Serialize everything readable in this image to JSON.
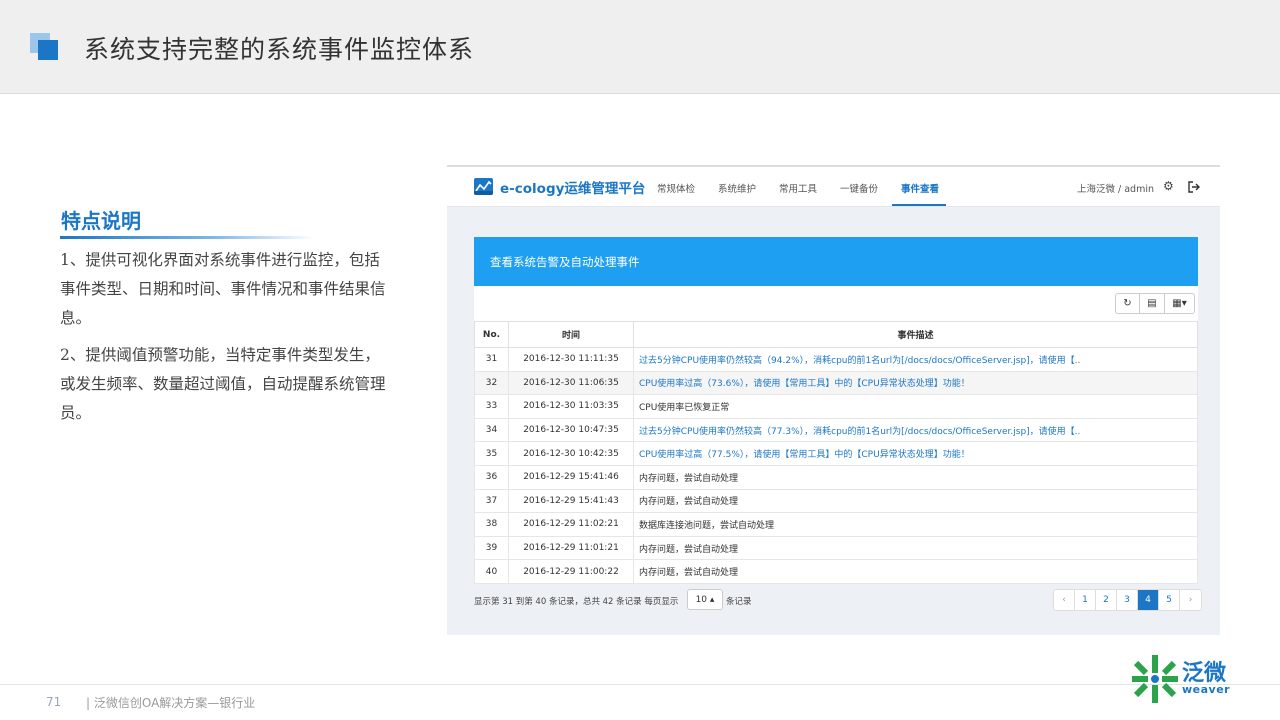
{
  "header": {
    "title": "系统支持完整的系统事件监控体系"
  },
  "features": {
    "title": "特点说明",
    "p1": "1、提供可视化界面对系统事件进行监控，包括事件类型、日期和时间、事件情况和事件结果信息。",
    "p2": "2、提供阈值预警功能，当特定事件类型发生，或发生频率、数量超过阈值，自动提醒系统管理员。"
  },
  "app": {
    "logo_text": "e-cology运维管理平台",
    "nav": [
      "常规体检",
      "系统维护",
      "常用工具",
      "一键备份",
      "事件查看"
    ],
    "user": "上海泛微 / admin",
    "panel_title": "查看系统告警及自动处理事件",
    "columns": {
      "no": "No.",
      "time": "时间",
      "desc": "事件描述"
    },
    "rows": [
      {
        "no": "31",
        "time": "2016-12-30 11:11:35",
        "desc": "过去5分钟CPU使用率仍然较高（94.2%），消耗cpu的前1名url为[/docs/docs/OfficeServer.jsp]，请使用【..",
        "link": true
      },
      {
        "no": "32",
        "time": "2016-12-30 11:06:35",
        "desc": "CPU使用率过高（73.6%），请使用【常用工具】中的【CPU异常状态处理】功能！",
        "link": true
      },
      {
        "no": "33",
        "time": "2016-12-30 11:03:35",
        "desc": "CPU使用率已恢复正常",
        "link": false
      },
      {
        "no": "34",
        "time": "2016-12-30 10:47:35",
        "desc": "过去5分钟CPU使用率仍然较高（77.3%），消耗cpu的前1名url为[/docs/docs/OfficeServer.jsp]，请使用【..",
        "link": true
      },
      {
        "no": "35",
        "time": "2016-12-30 10:42:35",
        "desc": "CPU使用率过高（77.5%），请使用【常用工具】中的【CPU异常状态处理】功能！",
        "link": true
      },
      {
        "no": "36",
        "time": "2016-12-29 15:41:46",
        "desc": "内存问题，尝试自动处理",
        "link": false
      },
      {
        "no": "37",
        "time": "2016-12-29 15:41:43",
        "desc": "内存问题，尝试自动处理",
        "link": false
      },
      {
        "no": "38",
        "time": "2016-12-29 11:02:21",
        "desc": "数据库连接池问题，尝试自动处理",
        "link": false
      },
      {
        "no": "39",
        "time": "2016-12-29 11:01:21",
        "desc": "内存问题，尝试自动处理",
        "link": false
      },
      {
        "no": "40",
        "time": "2016-12-29 11:00:22",
        "desc": "内存问题，尝试自动处理",
        "link": false
      }
    ],
    "pager": {
      "info": "显示第 31 到第 40 条记录，总共 42 条记录 每页显示",
      "page_size": "10 ▴",
      "suffix": "条记录",
      "prev": "‹",
      "pages": [
        "1",
        "2",
        "3",
        "4",
        "5"
      ],
      "active": "4",
      "next": "›"
    }
  },
  "footer": {
    "page_number": "71",
    "text": "| 泛微信创OA解决方案—银行业",
    "brand_name": "泛微",
    "brand_sub": "weaver"
  },
  "colors": {
    "accent": "#1b77c6",
    "panel_header": "#1e9ff2",
    "brand_green": "#2aa34a"
  }
}
